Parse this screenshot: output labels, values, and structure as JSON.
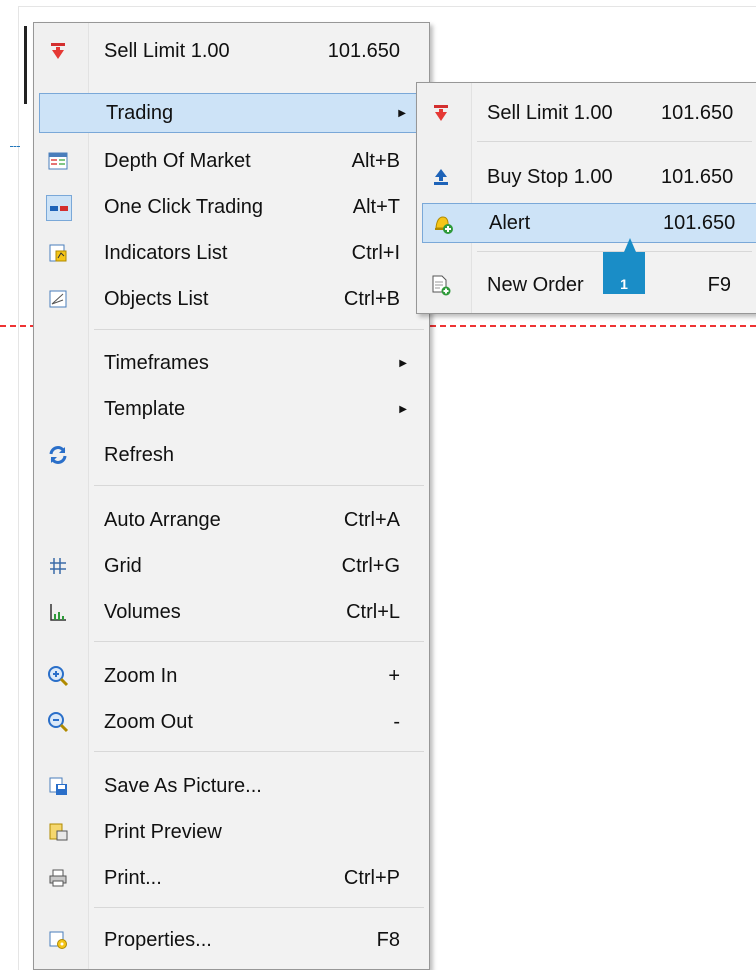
{
  "context_menu": {
    "items": [
      {
        "label": "Sell Limit 1.00",
        "shortcut": "101.650",
        "icon": "sell-arrow-icon"
      },
      {
        "label": "Trading",
        "shortcut": "",
        "icon": "",
        "has_submenu": true,
        "highlighted": true
      },
      {
        "label": "Depth Of Market",
        "shortcut": "Alt+B",
        "icon": "depth-of-market-icon"
      },
      {
        "label": "One Click Trading",
        "shortcut": "Alt+T",
        "icon": "one-click-trading-icon"
      },
      {
        "label": "Indicators List",
        "shortcut": "Ctrl+I",
        "icon": "indicators-list-icon"
      },
      {
        "label": "Objects List",
        "shortcut": "Ctrl+B",
        "icon": "objects-list-icon"
      },
      {
        "label": "Timeframes",
        "shortcut": "",
        "has_submenu": true
      },
      {
        "label": "Template",
        "shortcut": "",
        "has_submenu": true
      },
      {
        "label": "Refresh",
        "shortcut": "",
        "icon": "refresh-icon"
      },
      {
        "label": "Auto Arrange",
        "shortcut": "Ctrl+A"
      },
      {
        "label": "Grid",
        "shortcut": "Ctrl+G",
        "icon": "grid-icon"
      },
      {
        "label": "Volumes",
        "shortcut": "Ctrl+L",
        "icon": "volumes-icon"
      },
      {
        "label": "Zoom In",
        "shortcut": "+",
        "icon": "zoom-in-icon"
      },
      {
        "label": "Zoom Out",
        "shortcut": "-",
        "icon": "zoom-out-icon"
      },
      {
        "label": "Save As Picture...",
        "shortcut": "",
        "icon": "save-picture-icon"
      },
      {
        "label": "Print Preview",
        "shortcut": "",
        "icon": "print-preview-icon"
      },
      {
        "label": "Print...",
        "shortcut": "Ctrl+P",
        "icon": "printer-icon"
      },
      {
        "label": "Properties...",
        "shortcut": "F8",
        "icon": "properties-icon"
      }
    ]
  },
  "trading_submenu": {
    "items": [
      {
        "label": "Sell Limit 1.00",
        "value": "101.650",
        "icon": "sell-arrow-icon"
      },
      {
        "label": "Buy Stop 1.00",
        "value": "101.650",
        "icon": "buy-arrow-icon"
      },
      {
        "label": "Alert",
        "value": "101.650",
        "icon": "alert-bell-icon",
        "highlighted": true
      },
      {
        "label": "New Order",
        "value": "F9",
        "icon": "new-order-icon"
      }
    ]
  },
  "callout_marker": "1",
  "colors": {
    "highlight": "#cde3f7",
    "price_line": "#e33333",
    "marker": "#1a8dc7"
  }
}
